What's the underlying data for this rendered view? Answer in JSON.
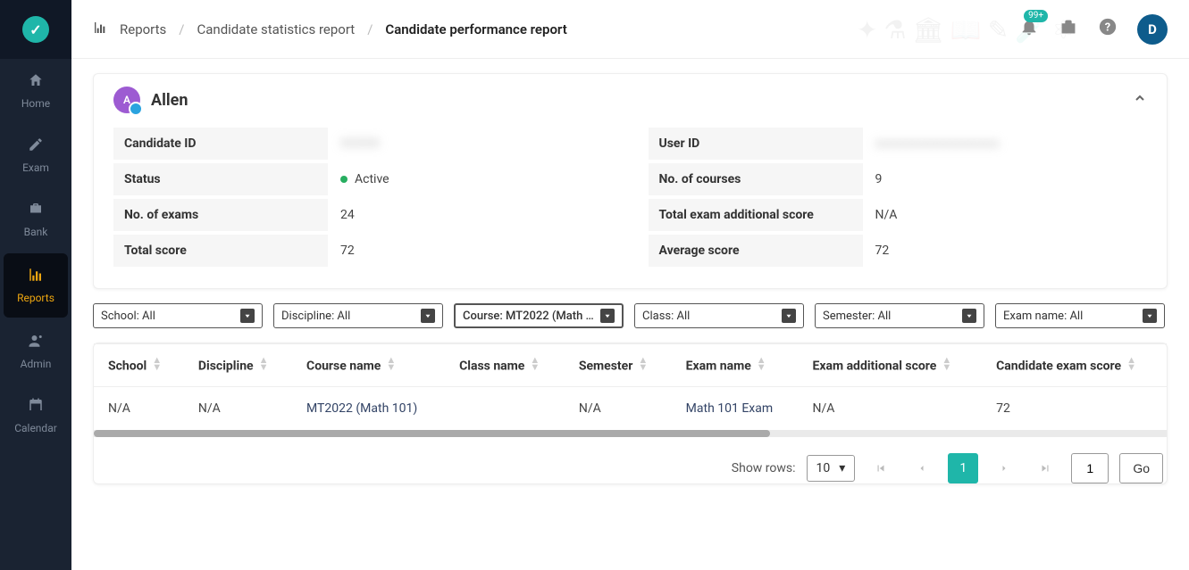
{
  "sidebar": {
    "logo_letter": "✓",
    "items": [
      {
        "id": "home",
        "label": "Home",
        "icon": "home-icon"
      },
      {
        "id": "exam",
        "label": "Exam",
        "icon": "pencil-icon"
      },
      {
        "id": "bank",
        "label": "Bank",
        "icon": "briefcase-icon"
      },
      {
        "id": "reports",
        "label": "Reports",
        "icon": "chart-icon",
        "active": true
      },
      {
        "id": "admin",
        "label": "Admin",
        "icon": "user-gear-icon"
      },
      {
        "id": "calendar",
        "label": "Calendar",
        "icon": "calendar-icon"
      }
    ]
  },
  "header": {
    "breadcrumb_icon": "chart-icon",
    "breadcrumb": [
      "Reports",
      "Candidate statistics report",
      "Candidate performance report"
    ],
    "notifications_badge": "99+",
    "avatar_initial": "D"
  },
  "candidate": {
    "avatar_letter": "A",
    "name": "Allen",
    "summary": {
      "left": [
        {
          "label": "Candidate ID",
          "value": "XXXXX",
          "blur": true
        },
        {
          "label": "Status",
          "value": "Active",
          "status": true
        },
        {
          "label": "No. of exams",
          "value": "24"
        },
        {
          "label": "Total score",
          "value": "72"
        }
      ],
      "right": [
        {
          "label": "User ID",
          "value": "xxxxxxxxxxxxxxxxxxxx",
          "blur": true
        },
        {
          "label": "No. of courses",
          "value": "9"
        },
        {
          "label": "Total exam additional score",
          "value": "N/A"
        },
        {
          "label": "Average score",
          "value": "72"
        }
      ]
    }
  },
  "filters": [
    {
      "label": "School: All"
    },
    {
      "label": "Discipline: All"
    },
    {
      "label": "Course: MT2022 (Math …",
      "active": true
    },
    {
      "label": "Class: All"
    },
    {
      "label": "Semester: All"
    },
    {
      "label": "Exam name: All"
    }
  ],
  "table": {
    "columns": [
      "School",
      "Discipline",
      "Course name",
      "Class name",
      "Semester",
      "Exam name",
      "Exam additional score",
      "Candidate exam score"
    ],
    "rows": [
      {
        "school": "N/A",
        "discipline": "N/A",
        "course_name": "MT2022 (Math 101)",
        "class_name": "",
        "semester": "N/A",
        "exam_name": "Math 101 Exam",
        "exam_additional_score": "N/A",
        "candidate_exam_score": "72"
      }
    ]
  },
  "pagination": {
    "show_rows_label": "Show rows:",
    "rows_per_page": "10",
    "current_page": "1",
    "page_input": "1",
    "go_label": "Go"
  }
}
